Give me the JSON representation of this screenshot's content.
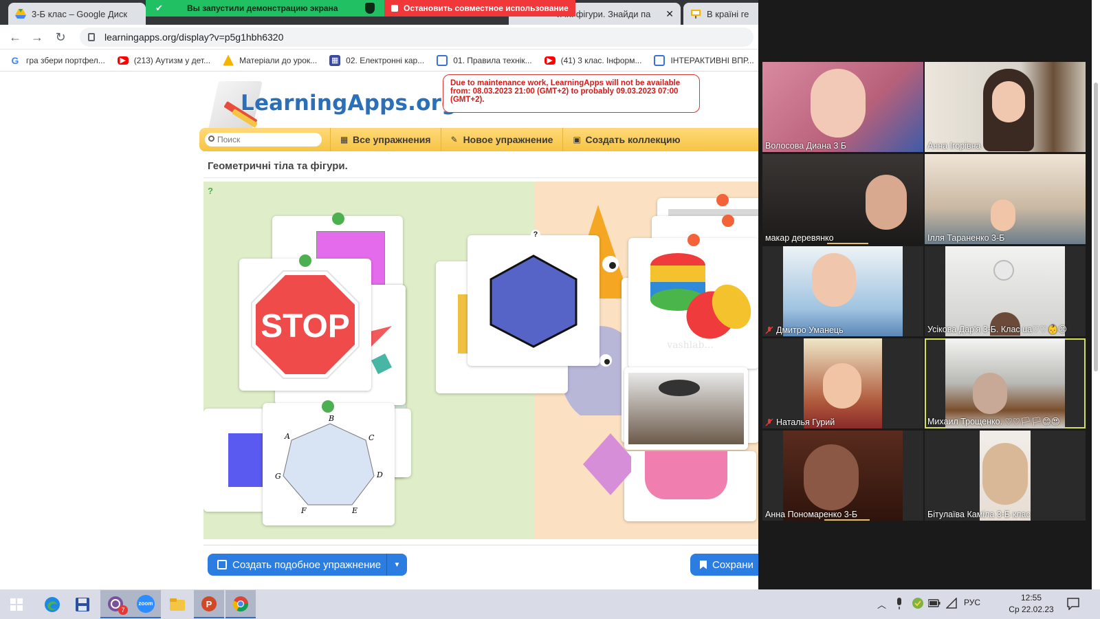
{
  "browser": {
    "tabs": [
      {
        "label": "3-Б клас – Google Диск"
      },
      {
        "label": "ичні фігури. Знайди па"
      },
      {
        "label": "В країні ге"
      }
    ],
    "share_banner": {
      "running": "Вы запустили демонстрацию экрана",
      "stop": "Остановить совместное использование"
    },
    "url": "learningapps.org/display?v=p5g1hbh6320",
    "bookmarks": [
      {
        "label": "гра збери портфел...",
        "icon": "google-icon"
      },
      {
        "label": "(213) Аутизм у дет...",
        "icon": "youtube-icon"
      },
      {
        "label": "Матеріали до урок...",
        "icon": "pyramid-icon"
      },
      {
        "label": "02. Електронні кар...",
        "icon": "grid-icon"
      },
      {
        "label": "01. Правила технік...",
        "icon": "doc-icon"
      },
      {
        "label": "(41) 3 клас. Інформ...",
        "icon": "youtube-icon"
      },
      {
        "label": "ІНТЕРАКТИВНІ ВПР...",
        "icon": "doc-icon"
      }
    ]
  },
  "site": {
    "logo": "LearningApps.org",
    "notice": "Due to maintenance work, LearningApps will not be available from: 08.03.2023 21:00 (GMT+2) to probably 09.03.2023 07:00 (GMT+2).",
    "search_placeholder": "Поиск",
    "nav": [
      {
        "label": "Все упражнения",
        "icon": "grid-icon"
      },
      {
        "label": "Новое упражнение",
        "icon": "pencil-icon"
      },
      {
        "label": "Создать коллекцию",
        "icon": "collection-icon"
      }
    ],
    "task_title": "Геометричні тіла та фігури.",
    "game": {
      "stop_sign": "STOP",
      "question_mark": "?",
      "heptagon_vertices": [
        "B",
        "C",
        "D",
        "E",
        "F",
        "G",
        "A"
      ],
      "watermark": "vashlab..."
    },
    "create_similar": "Создать подобное упражнение",
    "save": "Сохрани"
  },
  "zoom": {
    "participants": [
      {
        "name": "Волосова Диана 3 Б",
        "muted": false
      },
      {
        "name": "Анна Ігорівна",
        "muted": false
      },
      {
        "name": "макар  деревянко",
        "muted": false
      },
      {
        "name": "Ілля Тараненко 3-Б",
        "muted": false
      },
      {
        "name": "Дмитро Уманець",
        "muted": true
      },
      {
        "name": "Усікова Дар'я 3-Б. Клас ua♡♡👶😊",
        "muted": false
      },
      {
        "name": "Наталья Гурий",
        "muted": true
      },
      {
        "name": "Михаил Трощенко. ♡♡🏳🏳😊😍",
        "muted": false
      },
      {
        "name": "Анна Пономаренко 3-Б",
        "muted": false
      },
      {
        "name": "Бітулаїва Каміла 3-Б клас",
        "muted": false
      }
    ]
  },
  "taskbar": {
    "apps": [
      "windows-start-icon",
      "edge-icon",
      "save-disk-icon",
      "viber-icon",
      "zoom-icon",
      "file-explorer-icon",
      "powerpoint-icon",
      "chrome-icon"
    ],
    "viber_badge": "7",
    "zoom_label": "zoom",
    "lang": "РУС",
    "time": "12:55",
    "date": "Ср 22.02.23"
  },
  "colors": {
    "accent": "#2b7de1",
    "nav_yellow": "#f6c443",
    "share_green": "#21c063",
    "share_red": "#f0383a",
    "notice_red": "#d61a1a"
  }
}
